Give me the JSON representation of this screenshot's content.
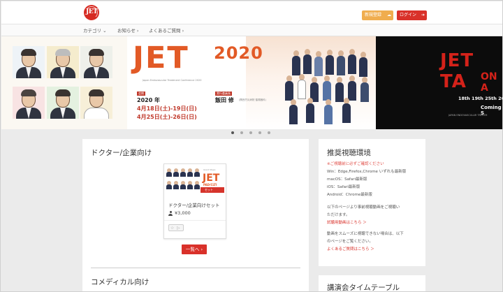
{
  "header": {
    "logo_text": "JET",
    "register_label": "新規登録",
    "login_label": "ログイン",
    "register_icon": "cloud-icon",
    "login_icon": "sign-in-icon"
  },
  "nav": {
    "items": [
      {
        "label": "カテゴリ ⌄"
      },
      {
        "label": "お知らせ ›"
      },
      {
        "label": "よくあるご質問 ›"
      }
    ]
  },
  "carousel": {
    "main": {
      "title": "JET",
      "year": "2020",
      "subtitle": "Japan Endovascular Treatment Conference 2020",
      "tag_period": "会期",
      "period_year": "2020 年",
      "date1": "4月18日(土)-19日(日)",
      "date2": "4月25日(土)-26日(日)",
      "tag_chair": "実行委員長",
      "chair_name": "飯田 修",
      "chair_affiliation": "(関西労災病院 循環器科)"
    },
    "right": {
      "title": "JET TA",
      "on": "ON A",
      "dates": "18th 19th 25th 26th",
      "coming": "Coming S",
      "small": "JAPAN ENDOVASCULAR TREATM"
    },
    "active_slide": 1,
    "slide_count": 5
  },
  "doctors_section": {
    "heading": "ドクター/企業向け",
    "card": {
      "image_title": "JET",
      "image_tag": "PAD/CLTI",
      "image_set": "セット",
      "image_sub": "Giant Steps",
      "title": "ドクター/企業向けセット",
      "price": "¥3,000"
    },
    "list_button": "一覧へ ›"
  },
  "comedical_section": {
    "heading": "コメディカル向け"
  },
  "env_section": {
    "heading": "推奨視聴環境",
    "warning": "※ご視聴前に必ずご確認ください",
    "lines": [
      "Win：Edge,Firefox,Chrome いずれも最新版",
      "macOS：Safari最新版",
      "iOS：Safari最新版",
      "Android：Chrome最新版"
    ],
    "note1a": "以下のページより事前視聴動画をご視聴い",
    "note1b": "ただけます。",
    "link1": "試聴用動画はこちら ＞",
    "note2a": "動画をスムーズに視聴できない場合は、以下",
    "note2b": "のページをご覧ください。",
    "link2": "よくあるご質問はこちら ＞"
  },
  "timetable_section": {
    "heading": "講演会タイムテーブル"
  }
}
